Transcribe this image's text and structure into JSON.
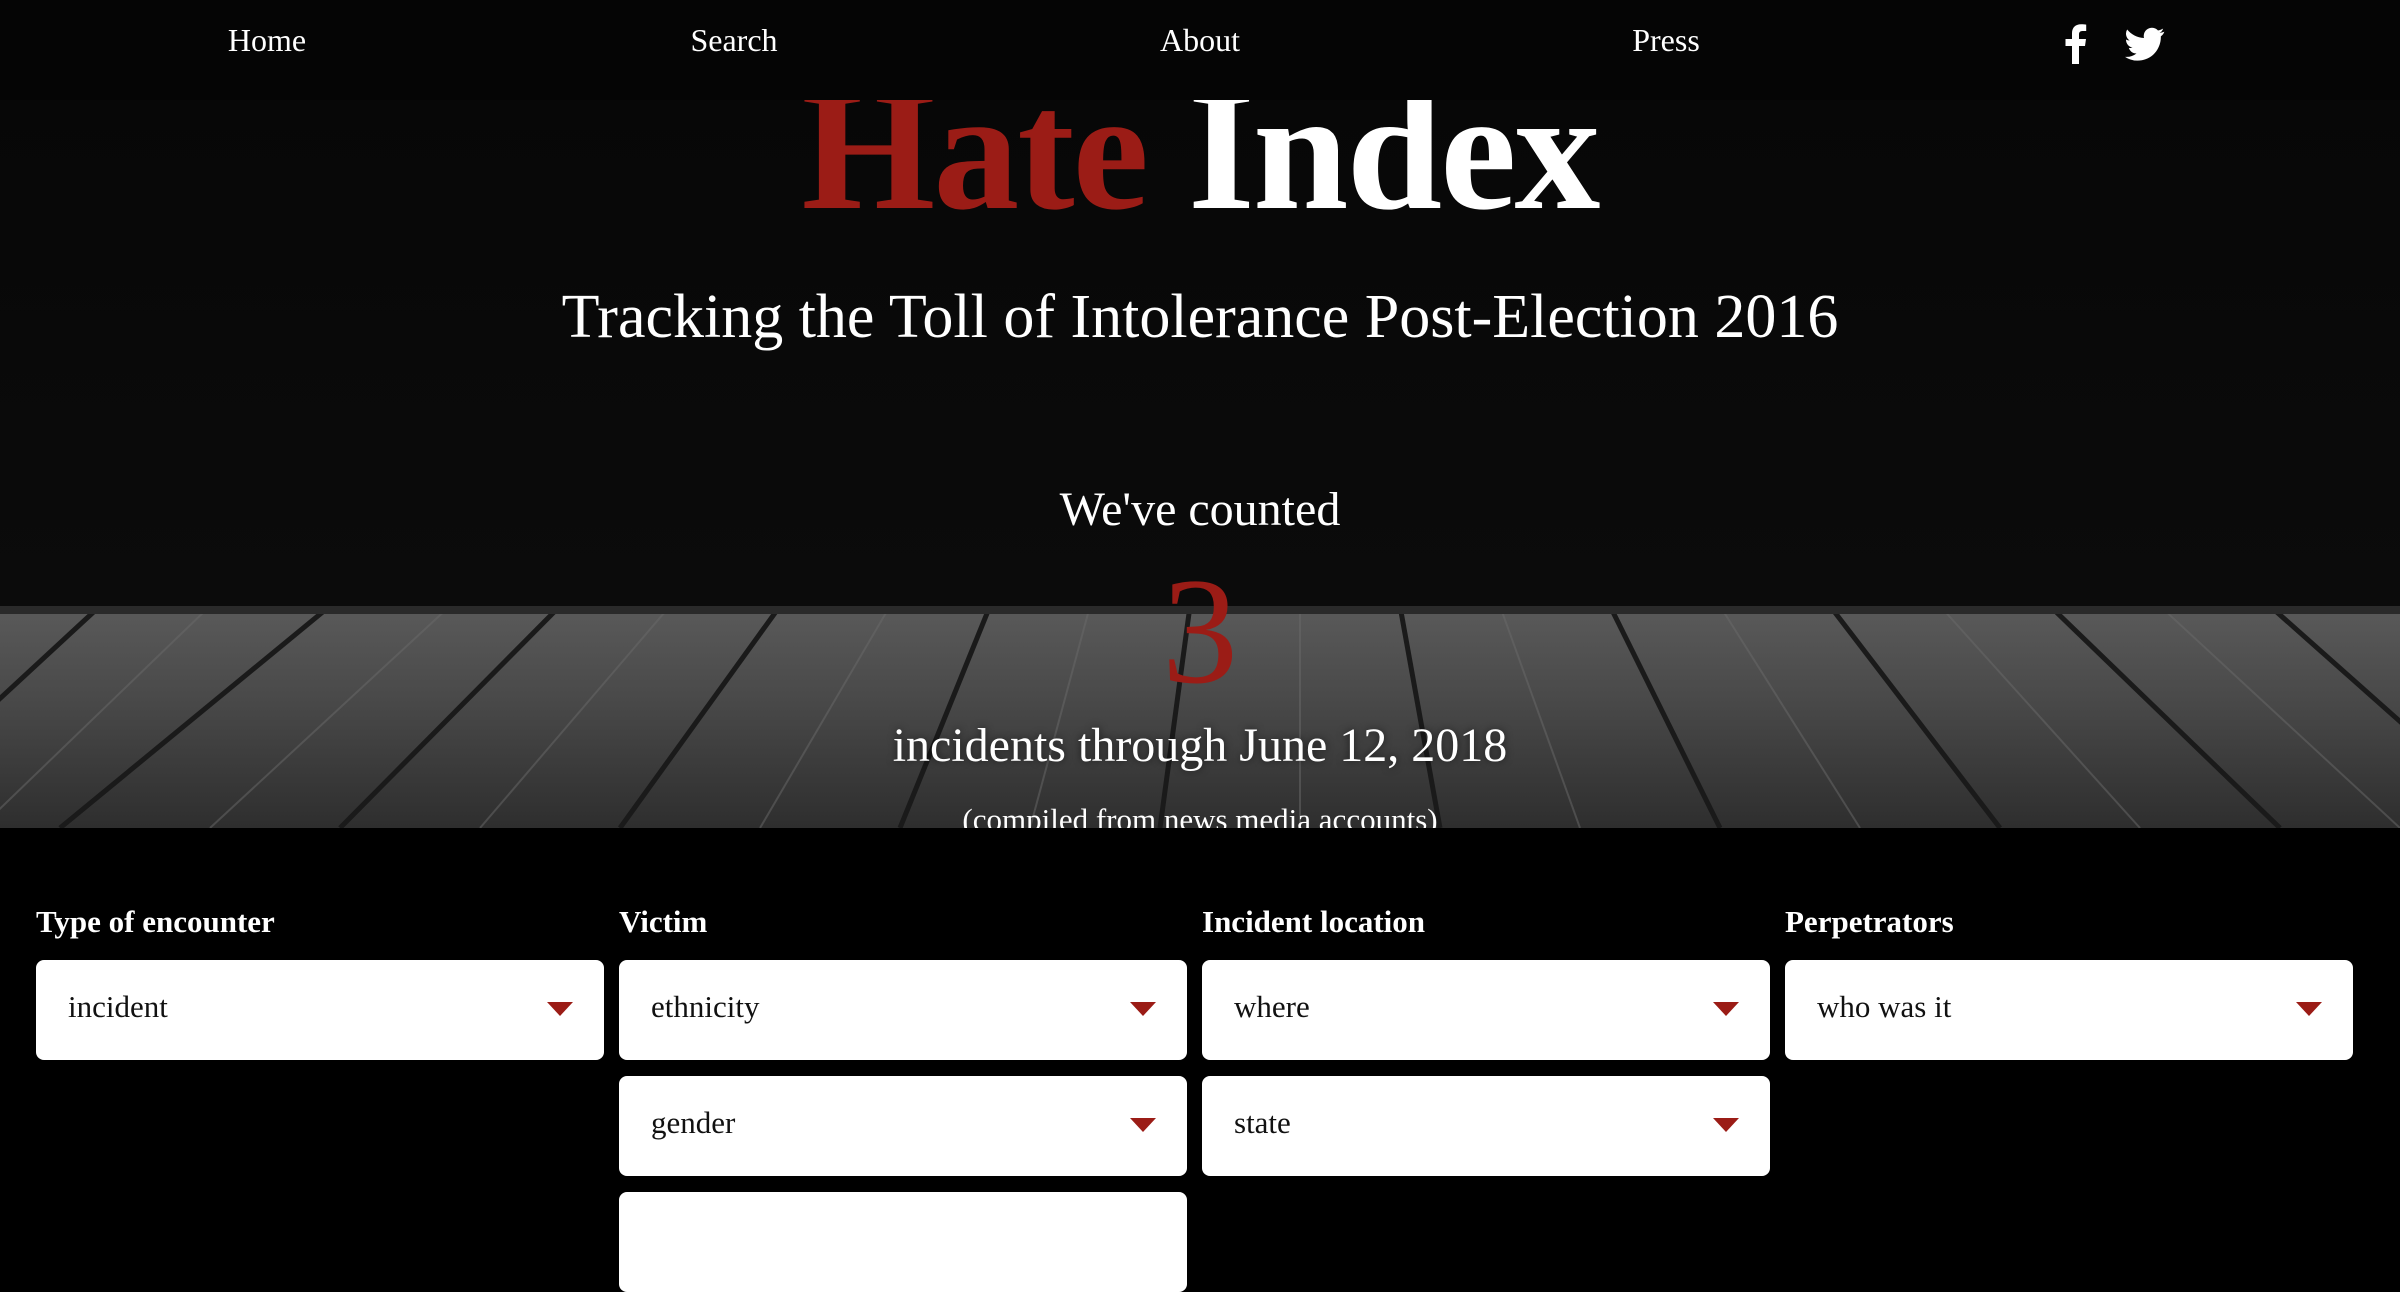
{
  "nav": {
    "items": [
      {
        "label": "Home"
      },
      {
        "label": "Search"
      },
      {
        "label": "About"
      },
      {
        "label": "Press"
      }
    ],
    "social": [
      "facebook-icon",
      "twitter-icon"
    ]
  },
  "hero": {
    "title_part1": "Hate",
    "title_part2": "Index",
    "subtitle": "Tracking the Toll of Intolerance Post-Election 2016",
    "counted_label": "We've counted",
    "count": "3",
    "through_text": "incidents through June 12, 2018",
    "source_note": "(compiled from news media accounts)"
  },
  "filters": {
    "columns": [
      {
        "label": "Type of encounter",
        "selects": [
          {
            "value": "incident"
          }
        ]
      },
      {
        "label": "Victim",
        "selects": [
          {
            "value": "ethnicity"
          },
          {
            "value": "gender"
          },
          {
            "value": ""
          }
        ]
      },
      {
        "label": "Incident location",
        "selects": [
          {
            "value": "where"
          },
          {
            "value": "state"
          }
        ]
      },
      {
        "label": "Perpetrators",
        "selects": [
          {
            "value": "who was it"
          }
        ]
      }
    ]
  },
  "colors": {
    "accent_red": "#9b1c16",
    "background": "#000000",
    "text": "#ffffff"
  }
}
